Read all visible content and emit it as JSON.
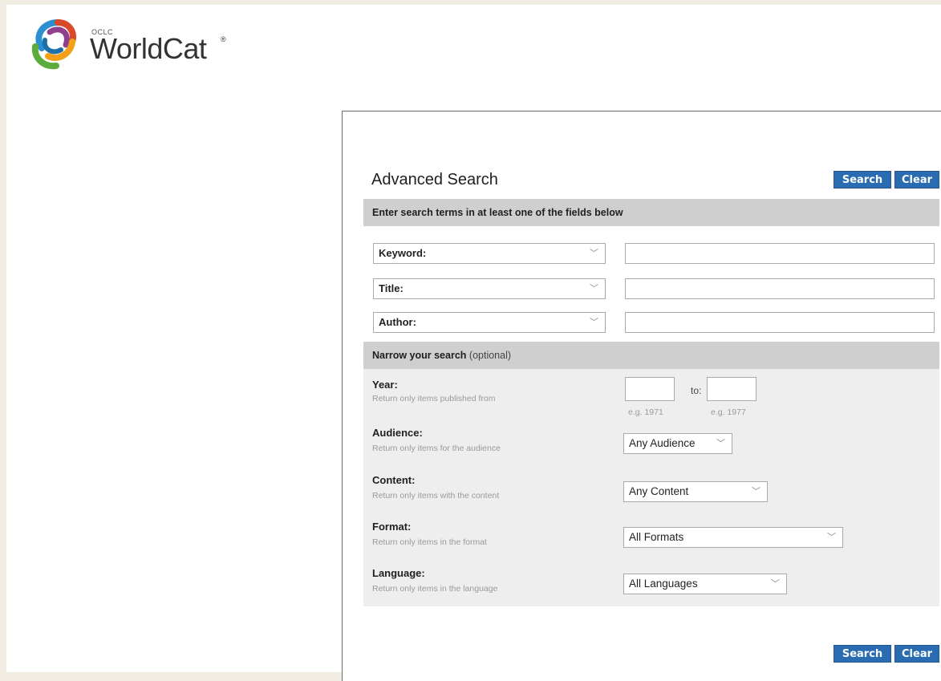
{
  "logo": {
    "oclc": "OCLC",
    "name": "WorldCat",
    "trademark": "®",
    "icon": "worldcat-logo-icon"
  },
  "search": {
    "title": "Advanced Search",
    "search_label": "Search",
    "clear_label": "Clear",
    "instruction": "Enter search terms in at least one of the fields below",
    "fields": [
      {
        "selected": "Keyword:",
        "value": ""
      },
      {
        "selected": "Title:",
        "value": ""
      },
      {
        "selected": "Author:",
        "value": ""
      }
    ]
  },
  "narrow": {
    "heading": "Narrow your search",
    "optional": "(optional)",
    "year": {
      "label": "Year:",
      "hint": "Return only items published from",
      "to": "to:",
      "from_example": "e.g. 1971",
      "to_example": "e.g. 1977"
    },
    "audience": {
      "label": "Audience:",
      "hint": "Return only items for the audience",
      "selected": "Any Audience"
    },
    "content": {
      "label": "Content:",
      "hint": "Return only items with the content",
      "selected": "Any Content"
    },
    "format": {
      "label": "Format:",
      "hint": "Return only items in the format",
      "selected": "All Formats"
    },
    "language": {
      "label": "Language:",
      "hint": "Return only items in the language",
      "selected": "All Languages"
    }
  },
  "colors": {
    "button": "#2a6cb1",
    "band": "#cfcfcf",
    "narrow_bg": "#eeeeee",
    "page_border": "#f1ede2"
  }
}
